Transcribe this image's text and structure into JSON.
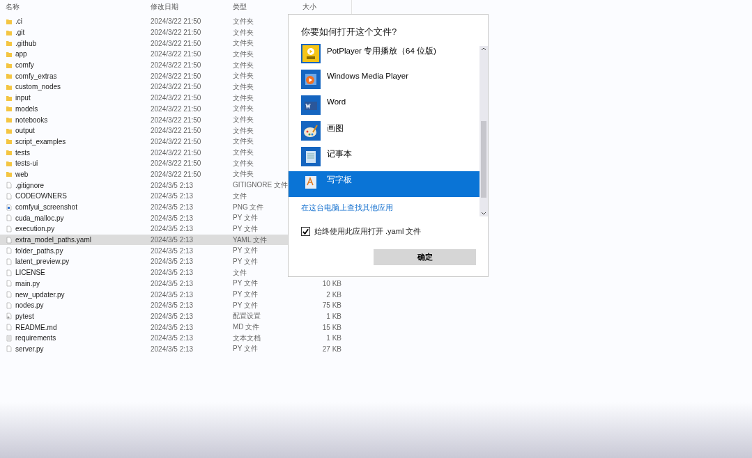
{
  "file_list": {
    "columns": [
      "名称",
      "修改日期",
      "类型",
      "大小"
    ],
    "rows": [
      {
        "kind": "folder",
        "name": ".ci",
        "date": "2024/3/22 21:50",
        "type": "文件夹",
        "selected": false
      },
      {
        "kind": "folder",
        "name": ".git",
        "date": "2024/3/22 21:50",
        "type": "文件夹",
        "selected": false
      },
      {
        "kind": "folder",
        "name": ".github",
        "date": "2024/3/22 21:50",
        "type": "文件夹",
        "selected": false
      },
      {
        "kind": "folder",
        "name": "app",
        "date": "2024/3/22 21:50",
        "type": "文件夹",
        "selected": false
      },
      {
        "kind": "folder",
        "name": "comfy",
        "date": "2024/3/22 21:50",
        "type": "文件夹",
        "selected": false
      },
      {
        "kind": "folder",
        "name": "comfy_extras",
        "date": "2024/3/22 21:50",
        "type": "文件夹",
        "selected": false
      },
      {
        "kind": "folder",
        "name": "custom_nodes",
        "date": "2024/3/22 21:50",
        "type": "文件夹",
        "selected": false
      },
      {
        "kind": "folder",
        "name": "input",
        "date": "2024/3/22 21:50",
        "type": "文件夹",
        "selected": false
      },
      {
        "kind": "folder",
        "name": "models",
        "date": "2024/3/22 21:50",
        "type": "文件夹",
        "selected": false
      },
      {
        "kind": "folder",
        "name": "notebooks",
        "date": "2024/3/22 21:50",
        "type": "文件夹",
        "selected": false
      },
      {
        "kind": "folder",
        "name": "output",
        "date": "2024/3/22 21:50",
        "type": "文件夹",
        "selected": false
      },
      {
        "kind": "folder",
        "name": "script_examples",
        "date": "2024/3/22 21:50",
        "type": "文件夹",
        "selected": false
      },
      {
        "kind": "folder",
        "name": "tests",
        "date": "2024/3/22 21:50",
        "type": "文件夹",
        "selected": false
      },
      {
        "kind": "folder",
        "name": "tests-ui",
        "date": "2024/3/22 21:50",
        "type": "文件夹",
        "selected": false
      },
      {
        "kind": "folder",
        "name": "web",
        "date": "2024/3/22 21:50",
        "type": "文件夹",
        "selected": false
      },
      {
        "kind": "file",
        "name": ".gitignore",
        "date": "2024/3/5 2:13",
        "type": "GITIGNORE 文件",
        "selected": false
      },
      {
        "kind": "file",
        "name": "CODEOWNERS",
        "date": "2024/3/5 2:13",
        "type": "文件",
        "selected": false
      },
      {
        "kind": "image",
        "name": "comfyui_screenshot",
        "date": "2024/3/5 2:13",
        "type": "PNG 文件",
        "selected": false
      },
      {
        "kind": "file",
        "name": "cuda_malloc.py",
        "date": "2024/3/5 2:13",
        "type": "PY 文件",
        "selected": false
      },
      {
        "kind": "file",
        "name": "execution.py",
        "date": "2024/3/5 2:13",
        "type": "PY 文件",
        "selected": false
      },
      {
        "kind": "file",
        "name": "extra_model_paths.yaml",
        "date": "2024/3/5 2:13",
        "type": "YAML 文件",
        "selected": true
      },
      {
        "kind": "file",
        "name": "folder_paths.py",
        "date": "2024/3/5 2:13",
        "type": "PY 文件",
        "selected": false
      },
      {
        "kind": "file",
        "name": "latent_preview.py",
        "date": "2024/3/5 2:13",
        "type": "PY 文件",
        "selected": false
      },
      {
        "kind": "file",
        "name": "LICENSE",
        "date": "2024/3/5 2:13",
        "type": "文件",
        "selected": false
      },
      {
        "kind": "file",
        "name": "main.py",
        "date": "2024/3/5 2:13",
        "type": "PY 文件",
        "size": "10 KB",
        "selected": false
      },
      {
        "kind": "file",
        "name": "new_updater.py",
        "date": "2024/3/5 2:13",
        "type": "PY 文件",
        "size": "2 KB",
        "selected": false
      },
      {
        "kind": "file",
        "name": "nodes.py",
        "date": "2024/3/5 2:13",
        "type": "PY 文件",
        "size": "75 KB",
        "selected": false
      },
      {
        "kind": "settings",
        "name": "pytest",
        "date": "2024/3/5 2:13",
        "type": "配置设置",
        "size": "1 KB",
        "selected": false
      },
      {
        "kind": "file",
        "name": "README.md",
        "date": "2024/3/5 2:13",
        "type": "MD 文件",
        "size": "15 KB",
        "selected": false
      },
      {
        "kind": "text",
        "name": "requirements",
        "date": "2024/3/5 2:13",
        "type": "文本文档",
        "size": "1 KB",
        "selected": false
      },
      {
        "kind": "file",
        "name": "server.py",
        "date": "2024/3/5 2:13",
        "type": "PY 文件",
        "size": "27 KB",
        "selected": false
      }
    ]
  },
  "open_with_dialog": {
    "title": "你要如何打开这个文件?",
    "apps": [
      {
        "name": "PotPlayer 专用播放（64 位版)",
        "selected": false
      },
      {
        "name": "Windows Media Player",
        "selected": false
      },
      {
        "name": "Word",
        "selected": false
      },
      {
        "name": "画图",
        "selected": false
      },
      {
        "name": "记事本",
        "selected": false
      },
      {
        "name": "写字板",
        "selected": true
      }
    ],
    "more_apps_link": "在这台电脑上查找其他应用",
    "always_use": {
      "label": "始终使用此应用打开 .yaml 文件",
      "checked": true
    },
    "ok_button": "确定"
  }
}
